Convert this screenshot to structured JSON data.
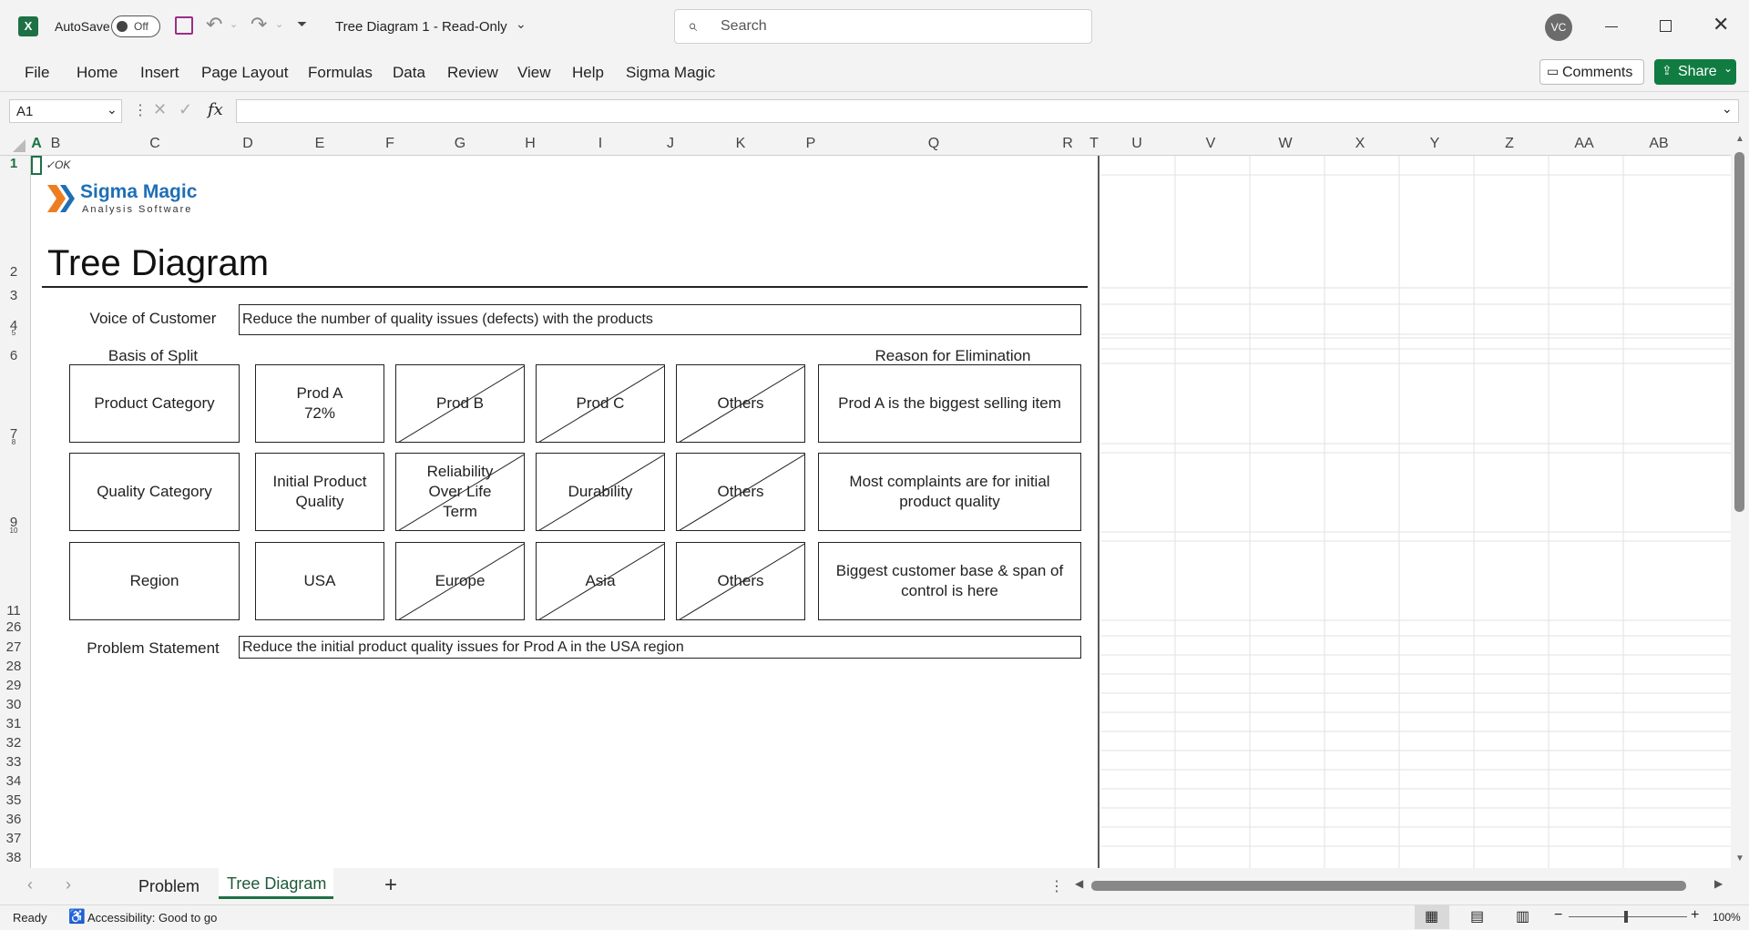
{
  "titlebar": {
    "autosave_label": "AutoSave",
    "autosave_state": "Off",
    "doc_title": "Tree Diagram 1  -  Read-Only",
    "search_placeholder": "Search",
    "user_initials": "VC"
  },
  "ribbon": {
    "tabs": [
      "File",
      "Home",
      "Insert",
      "Page Layout",
      "Formulas",
      "Data",
      "Review",
      "View",
      "Help",
      "Sigma Magic"
    ],
    "comments_label": "Comments",
    "share_label": "Share"
  },
  "formulabar": {
    "name_box": "A1",
    "fx": "fx",
    "formula": ""
  },
  "columns": [
    "A",
    "B",
    "C",
    "D",
    "E",
    "F",
    "G",
    "H",
    "I",
    "J",
    "K",
    "P",
    "Q",
    "R",
    "T",
    "U",
    "V",
    "W",
    "X",
    "Y",
    "Z",
    "AA",
    "AB"
  ],
  "rows": [
    "1",
    "2",
    "3",
    "4",
    "5",
    "6",
    "7",
    "8",
    "9",
    "10",
    "11",
    "26",
    "27",
    "28",
    "29",
    "30",
    "31",
    "32",
    "33",
    "34",
    "35",
    "36",
    "37",
    "38"
  ],
  "sheet": {
    "ok_mark": "✓OK",
    "logo_name": "Sigma Magic",
    "logo_sub": "Analysis Software",
    "title": "Tree Diagram",
    "voc_label": "Voice of Customer",
    "voc_value": "Reduce the number of quality issues (defects) with the products",
    "basis_header": "Basis of Split",
    "reason_header": "Reason for Elimination",
    "tree_rows": [
      {
        "basis": "Product Category",
        "options": [
          "Prod A\n72%",
          "Prod B",
          "Prod C",
          "Others"
        ],
        "reason": "Prod A is the biggest selling item"
      },
      {
        "basis": "Quality Category",
        "options": [
          "Initial Product Quality",
          "Reliability Over Life Term",
          "Durability",
          "Others"
        ],
        "reason": "Most complaints are for initial product quality"
      },
      {
        "basis": "Region",
        "options": [
          "USA",
          "Europe",
          "Asia",
          "Others"
        ],
        "reason": "Biggest customer base & span of control is here"
      }
    ],
    "problem_label": "Problem Statement",
    "problem_value": "Reduce the initial product  quality issues for Prod A in the USA region"
  },
  "sheettabs": {
    "tabs": [
      "Problem",
      "Tree Diagram"
    ],
    "active": "Tree Diagram",
    "add_label": "+"
  },
  "statusbar": {
    "ready": "Ready",
    "accessibility": "Accessibility: Good to go",
    "zoom": "100%"
  },
  "colors": {
    "excel_green": "#1e7145",
    "share_green": "#107c41",
    "logo_orange": "#ee7d22",
    "logo_blue": "#1f6fb5"
  }
}
